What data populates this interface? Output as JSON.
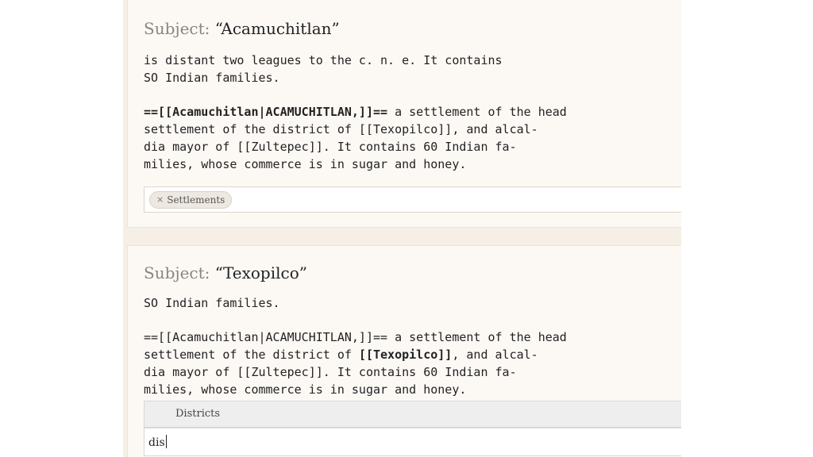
{
  "cards": [
    {
      "subject_label": "Subject:",
      "subject_value": "“Acamuchitlan”",
      "para1": "is distant two leagues to the c. n. e. It contains\nSO Indian families.",
      "para2_bold": "==[[Acamuchitlan|ACAMUCHITLAN,]]==",
      "para2_rest": " a settlement of the head\nsettlement of the district of [[Texopilco]], and alcal-\ndia mayor of [[Zultepec]]. It contains 60 Indian fa-\nmilies, whose commerce is in sugar and honey.",
      "tags": [
        {
          "remove": "×",
          "label": "Settlements"
        }
      ]
    },
    {
      "subject_label": "Subject:",
      "subject_value": "“Texopilco”",
      "para1": "SO Indian families.",
      "para2_a": "==[[Acamuchitlan|ACAMUCHITLAN,]]== a settlement of the head\nsettlement of the district of ",
      "para2_bold": "[[Texopilco]]",
      "para2_b": ", and alcal-\ndia mayor of [[Zultepec]]. It contains 60 Indian fa-\nmilies, whose commerce is in sugar and honey.",
      "dropdown_option": "Districts",
      "input_value": "dis"
    }
  ]
}
